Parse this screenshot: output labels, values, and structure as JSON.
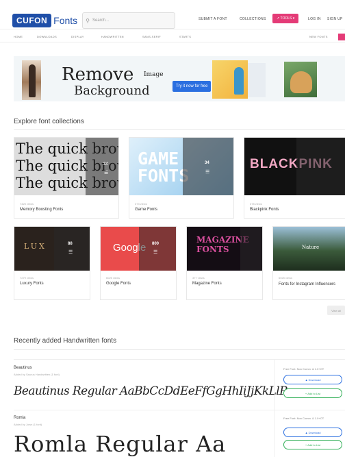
{
  "header": {
    "logo_box": "CUFON",
    "logo_text": "Fonts",
    "search_placeholder": "Search...",
    "nav": [
      "SUBMIT A FONT",
      "COLLECTIONS",
      "TOOLS",
      "LOG IN",
      "SIGN UP"
    ],
    "tools_label": "↗ TOOLS ▾"
  },
  "subnav": [
    "HOME",
    "DOWNLOADS",
    "DISPLAY",
    "HANDWRITTEN",
    "SANS-SERIF",
    "STARTS"
  ],
  "subnav_right": "NEW FONTS",
  "banner": {
    "word1": "Remove",
    "word_small": "Image",
    "word2": "Background",
    "cta": "Try it now for free"
  },
  "collections": {
    "title": "Explore font collections",
    "view_all": "View all",
    "items": [
      {
        "count": "7425 views",
        "name": "Memory Boosting Fonts",
        "num": "34",
        "art": "The quick brown"
      },
      {
        "count": "373 views",
        "name": "Game Fonts",
        "num": "34",
        "art": "GAME FONTS"
      },
      {
        "count": "378 views",
        "name": "Blackpink Fonts",
        "num": "",
        "art": "BLACKPINK"
      },
      {
        "count": "7279 views",
        "name": "Luxury Fonts",
        "num": "88",
        "art": "LUX"
      },
      {
        "count": "6025 views",
        "name": "Google Fonts",
        "num": "800",
        "art": "Google"
      },
      {
        "count": "377 views",
        "name": "Magazine Fonts",
        "num": "",
        "art": "MAGAZINE FONTS"
      },
      {
        "count": "6025 views",
        "name": "Fonts for Instagram Influencers",
        "num": "",
        "art": "Nature"
      }
    ]
  },
  "recent": {
    "title": "Recently added Handwritten fonts",
    "fonts": [
      {
        "name": "Beautinus",
        "meta": "Added by Saurus Handwritten (1 font)",
        "preview": "Beautinus Regular AaBbCcDdEeFfGgHhIiJjKkLlPp",
        "free_note": "Free Font: Non Comm. & 1.0+OT",
        "download": "Download",
        "add_list": "Add to List"
      },
      {
        "name": "Romla",
        "meta": "Added by Jown (1 font)",
        "preview": "Romla Regular Aa",
        "free_note": "Free Font: Non Comm. & 1.0+OT",
        "download": "Download",
        "add_list": "Add to List"
      }
    ]
  },
  "colors": {
    "brand": "#1f4fa8",
    "accent_pink": "#e43b77",
    "cta_blue": "#2b6fe0",
    "green": "#2fae55"
  }
}
